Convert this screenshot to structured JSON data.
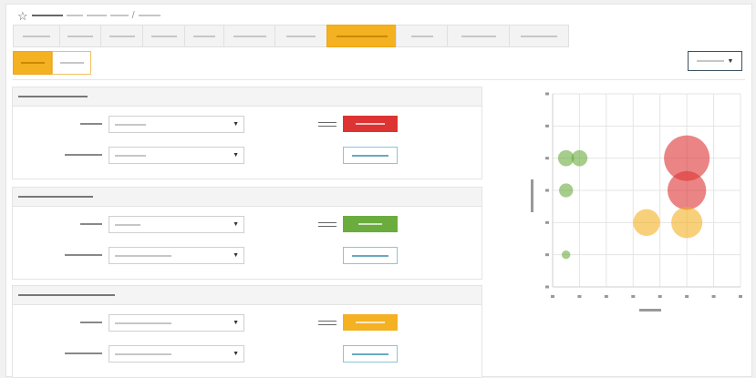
{
  "colors": {
    "accent": "#f4b121",
    "red": "#dd3333",
    "green": "#6aac3e",
    "outline": "#8bc4d8"
  },
  "breadcrumb": {
    "icon": "star-icon",
    "separator": "/"
  },
  "tabs": [
    {
      "w": 50,
      "active": false
    },
    {
      "w": 44,
      "active": false
    },
    {
      "w": 45,
      "active": false
    },
    {
      "w": 45,
      "active": false
    },
    {
      "w": 42,
      "active": false
    },
    {
      "w": 55,
      "active": false
    },
    {
      "w": 56,
      "active": false
    },
    {
      "w": 75,
      "active": true
    },
    {
      "w": 55,
      "active": false
    },
    {
      "w": 67,
      "active": false
    },
    {
      "w": 64,
      "active": false
    }
  ],
  "panels": [
    {
      "status_color": "red"
    },
    {
      "status_color": "green"
    },
    {
      "status_color": "amber"
    }
  ],
  "chart_data": {
    "type": "scatter",
    "title": "",
    "xlabel": "",
    "ylabel": "",
    "grid": true,
    "points": [
      {
        "x": 0.5,
        "y": 4.0,
        "r": 0.3,
        "color": "#6aac3e"
      },
      {
        "x": 1.0,
        "y": 4.0,
        "r": 0.3,
        "color": "#6aac3e"
      },
      {
        "x": 0.5,
        "y": 3.0,
        "r": 0.26,
        "color": "#6aac3e"
      },
      {
        "x": 0.5,
        "y": 1.0,
        "r": 0.16,
        "color": "#6aac3e"
      },
      {
        "x": 5.0,
        "y": 4.0,
        "r": 0.85,
        "color": "#dd3333"
      },
      {
        "x": 5.0,
        "y": 3.0,
        "r": 0.72,
        "color": "#dd3333"
      },
      {
        "x": 3.5,
        "y": 2.0,
        "r": 0.5,
        "color": "#f4b121"
      },
      {
        "x": 5.0,
        "y": 2.0,
        "r": 0.58,
        "color": "#f4b121"
      }
    ],
    "xlim": [
      0,
      7
    ],
    "ylim": [
      0,
      6
    ]
  }
}
